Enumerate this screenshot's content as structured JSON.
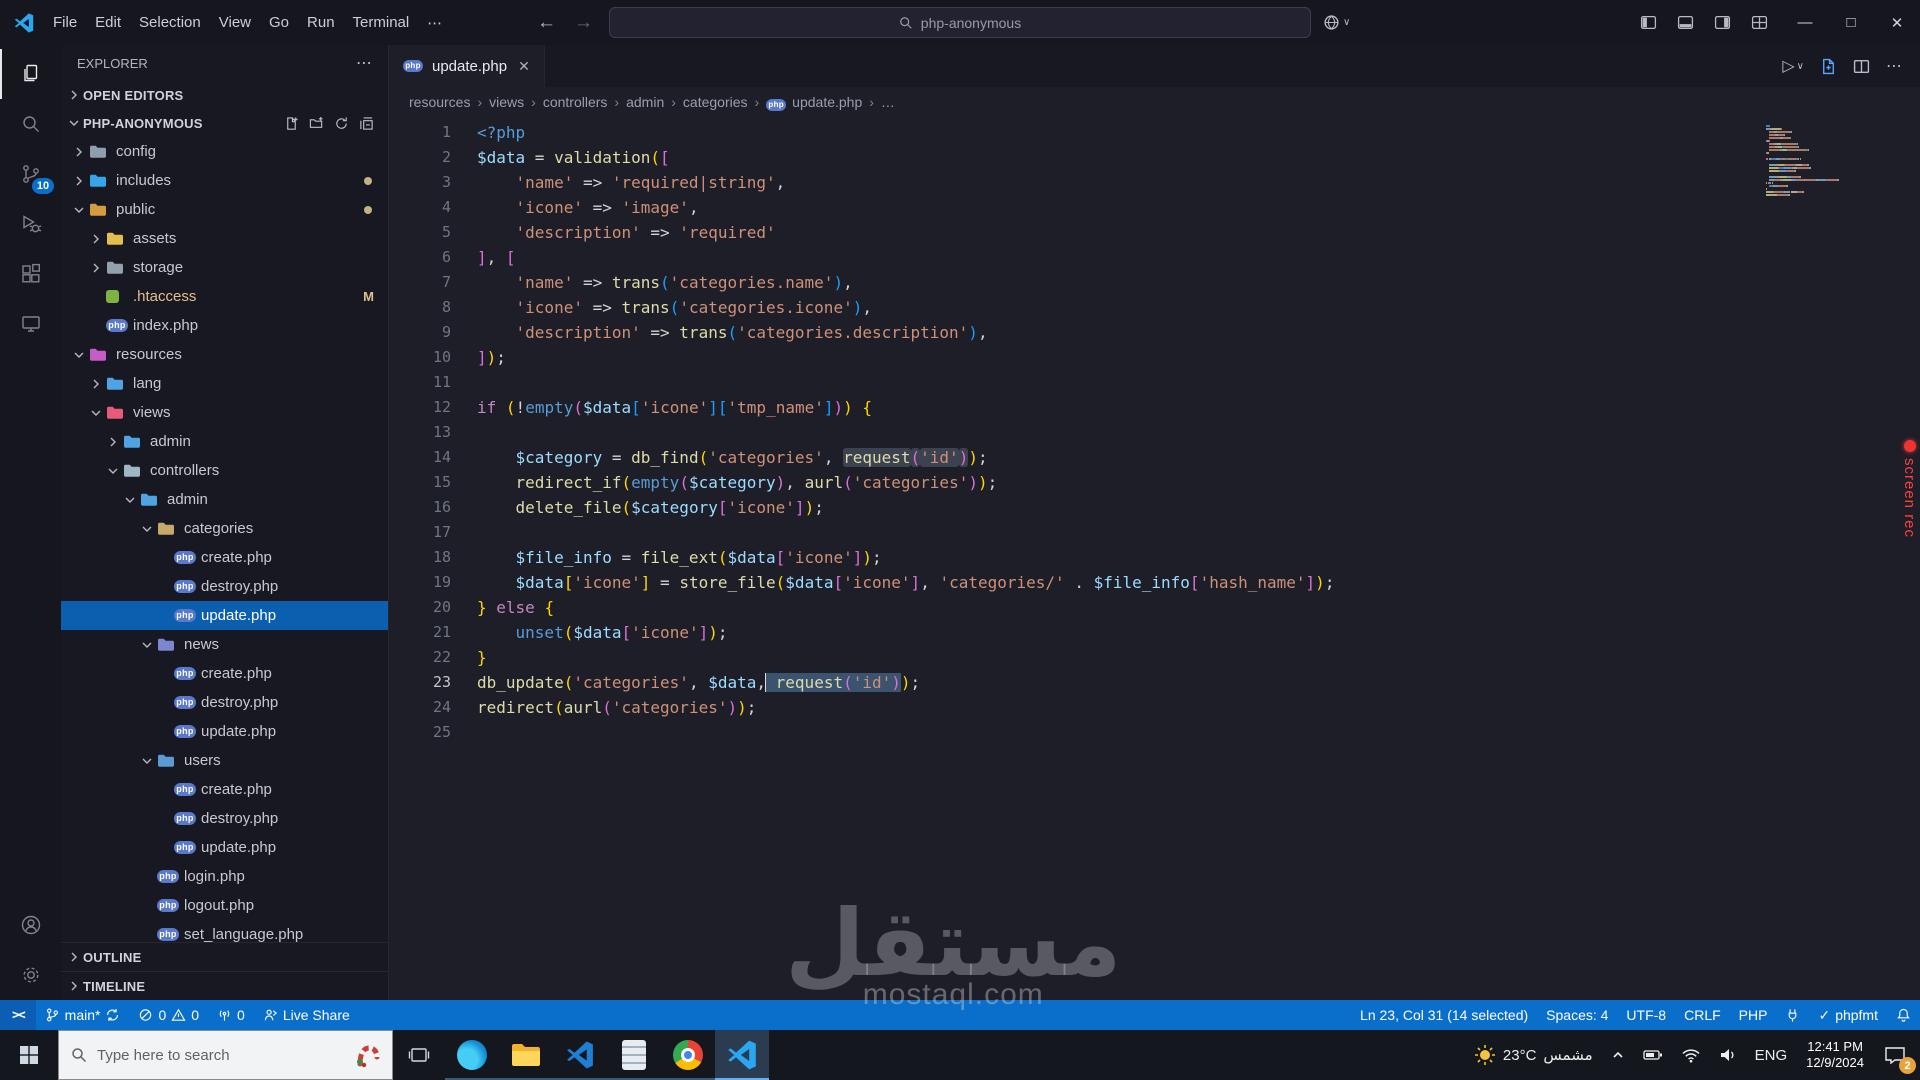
{
  "title_bar": {
    "menus": [
      "File",
      "Edit",
      "Selection",
      "View",
      "Go",
      "Run",
      "Terminal"
    ],
    "search_value": "php-anonymous"
  },
  "glyphs": {
    "more": "⋯",
    "close": "✕",
    "back": "←",
    "forward": "→",
    "crumb_sep": "›",
    "check": "✓",
    "minimize": "—",
    "maximize": "□",
    "caret_down": "∨",
    "play": "▷",
    "remote": "><"
  },
  "activity_bar": {
    "source_control_badge": "10"
  },
  "sidebar": {
    "title": "EXPLORER",
    "open_editors": "OPEN EDITORS",
    "project": "PHP-ANONYMOUS",
    "outline": "OUTLINE",
    "timeline": "TIMELINE",
    "tree": [
      {
        "label": "config",
        "level": 0,
        "kind": "folder",
        "expanded": false,
        "color": "#8f9fb0"
      },
      {
        "label": "includes",
        "level": 0,
        "kind": "folder",
        "expanded": false,
        "color": "#35a4e8",
        "dot": true
      },
      {
        "label": "public",
        "level": 0,
        "kind": "folder",
        "expanded": true,
        "color": "#d79b3f",
        "dot": true
      },
      {
        "label": "assets",
        "level": 1,
        "kind": "folder",
        "expanded": false,
        "color": "#e3bf4e"
      },
      {
        "label": "storage",
        "level": 1,
        "kind": "folder",
        "expanded": false,
        "color": "#93a1ad"
      },
      {
        "label": ".htaccess",
        "level": 1,
        "kind": "file",
        "icon": "htaccess",
        "badge": "M"
      },
      {
        "label": "index.php",
        "level": 1,
        "kind": "file",
        "icon": "php"
      },
      {
        "label": "resources",
        "level": 0,
        "kind": "folder",
        "expanded": true,
        "color": "#c75bc7"
      },
      {
        "label": "lang",
        "level": 1,
        "kind": "folder",
        "expanded": false,
        "color": "#4fa3e3"
      },
      {
        "label": "views",
        "level": 1,
        "kind": "folder",
        "expanded": true,
        "color": "#e8597a"
      },
      {
        "label": "admin",
        "level": 2,
        "kind": "folder",
        "expanded": false,
        "color": "#4fa3e3"
      },
      {
        "label": "controllers",
        "level": 2,
        "kind": "folder",
        "expanded": true,
        "color": "#9fb6c3"
      },
      {
        "label": "admin",
        "level": 3,
        "kind": "folder",
        "expanded": true,
        "color": "#4fa3e3"
      },
      {
        "label": "categories",
        "level": 4,
        "kind": "folder",
        "expanded": true,
        "color": "#c9a96a"
      },
      {
        "label": "create.php",
        "level": 5,
        "kind": "file",
        "icon": "php"
      },
      {
        "label": "destroy.php",
        "level": 5,
        "kind": "file",
        "icon": "php"
      },
      {
        "label": "update.php",
        "level": 5,
        "kind": "file",
        "icon": "php",
        "selected": true
      },
      {
        "label": "news",
        "level": 4,
        "kind": "folder",
        "expanded": true,
        "color": "#7b88cf"
      },
      {
        "label": "create.php",
        "level": 5,
        "kind": "file",
        "icon": "php"
      },
      {
        "label": "destroy.php",
        "level": 5,
        "kind": "file",
        "icon": "php"
      },
      {
        "label": "update.php",
        "level": 5,
        "kind": "file",
        "icon": "php"
      },
      {
        "label": "users",
        "level": 4,
        "kind": "folder",
        "expanded": true,
        "color": "#5a9bd3"
      },
      {
        "label": "create.php",
        "level": 5,
        "kind": "file",
        "icon": "php"
      },
      {
        "label": "destroy.php",
        "level": 5,
        "kind": "file",
        "icon": "php"
      },
      {
        "label": "update.php",
        "level": 5,
        "kind": "file",
        "icon": "php"
      },
      {
        "label": "login.php",
        "level": 4,
        "kind": "file",
        "icon": "php"
      },
      {
        "label": "logout.php",
        "level": 4,
        "kind": "file",
        "icon": "php"
      },
      {
        "label": "set_language.php",
        "level": 4,
        "kind": "file",
        "icon": "php"
      }
    ]
  },
  "editor": {
    "tab_label": "update.php",
    "active_line": 23,
    "breadcrumbs": [
      {
        "label": "resources"
      },
      {
        "label": "views"
      },
      {
        "label": "controllers"
      },
      {
        "label": "admin"
      },
      {
        "label": "categories"
      },
      {
        "label": "update.php",
        "icon": "php"
      },
      {
        "label": "…"
      }
    ],
    "lines": [
      [
        [
          "c",
          "<?php"
        ]
      ],
      [
        [
          "v",
          "$data"
        ],
        [
          "p",
          " = "
        ],
        [
          "f",
          "validation"
        ],
        [
          "g",
          "("
        ],
        [
          "m",
          "["
        ]
      ],
      [
        [
          "p",
          "    "
        ],
        [
          "s",
          "'name'"
        ],
        [
          "p",
          " => "
        ],
        [
          "s",
          "'required|string'"
        ],
        [
          "p",
          ","
        ]
      ],
      [
        [
          "p",
          "    "
        ],
        [
          "s",
          "'icone'"
        ],
        [
          "p",
          " => "
        ],
        [
          "s",
          "'image'"
        ],
        [
          "p",
          ","
        ]
      ],
      [
        [
          "p",
          "    "
        ],
        [
          "s",
          "'description'"
        ],
        [
          "p",
          " => "
        ],
        [
          "s",
          "'required'"
        ]
      ],
      [
        [
          "m",
          "]"
        ],
        [
          "p",
          ", "
        ],
        [
          "m",
          "["
        ]
      ],
      [
        [
          "p",
          "    "
        ],
        [
          "s",
          "'name'"
        ],
        [
          "p",
          " => "
        ],
        [
          "f",
          "trans"
        ],
        [
          "b",
          "("
        ],
        [
          "s",
          "'categories.name'"
        ],
        [
          "b",
          ")"
        ],
        [
          "p",
          ","
        ]
      ],
      [
        [
          "p",
          "    "
        ],
        [
          "s",
          "'icone'"
        ],
        [
          "p",
          " => "
        ],
        [
          "f",
          "trans"
        ],
        [
          "b",
          "("
        ],
        [
          "s",
          "'categories.icone'"
        ],
        [
          "b",
          ")"
        ],
        [
          "p",
          ","
        ]
      ],
      [
        [
          "p",
          "    "
        ],
        [
          "s",
          "'description'"
        ],
        [
          "p",
          " => "
        ],
        [
          "f",
          "trans"
        ],
        [
          "b",
          "("
        ],
        [
          "s",
          "'categories.description'"
        ],
        [
          "b",
          ")"
        ],
        [
          "p",
          ","
        ]
      ],
      [
        [
          "m",
          "]"
        ],
        [
          "g",
          ")"
        ],
        [
          "p",
          ";"
        ]
      ],
      [],
      [
        [
          "k",
          "if"
        ],
        [
          "p",
          " "
        ],
        [
          "g",
          "("
        ],
        [
          "p",
          "!"
        ],
        [
          "c",
          "empty"
        ],
        [
          "m",
          "("
        ],
        [
          "v",
          "$data"
        ],
        [
          "b",
          "["
        ],
        [
          "s",
          "'icone'"
        ],
        [
          "b",
          "]"
        ],
        [
          "b",
          "["
        ],
        [
          "s",
          "'tmp_name'"
        ],
        [
          "b",
          "]"
        ],
        [
          "m",
          ")"
        ],
        [
          "g",
          ")"
        ],
        [
          "p",
          " "
        ],
        [
          "g",
          "{"
        ]
      ],
      [],
      [
        [
          "p",
          "    "
        ],
        [
          "v",
          "$category"
        ],
        [
          "p",
          " = "
        ],
        [
          "f",
          "db_find"
        ],
        [
          "g",
          "("
        ],
        [
          "s",
          "'categories'"
        ],
        [
          "p",
          ", "
        ],
        [
          "f",
          "request",
          "match"
        ],
        [
          "m",
          "(",
          "match"
        ],
        [
          "s",
          "'id'",
          "match"
        ],
        [
          "m",
          ")",
          "match"
        ],
        [
          "g",
          ")"
        ],
        [
          "p",
          ";"
        ]
      ],
      [
        [
          "p",
          "    "
        ],
        [
          "f",
          "redirect_if"
        ],
        [
          "g",
          "("
        ],
        [
          "c",
          "empty"
        ],
        [
          "m",
          "("
        ],
        [
          "v",
          "$category"
        ],
        [
          "m",
          ")"
        ],
        [
          "p",
          ", "
        ],
        [
          "f",
          "aurl"
        ],
        [
          "m",
          "("
        ],
        [
          "s",
          "'categories'"
        ],
        [
          "m",
          ")"
        ],
        [
          "g",
          ")"
        ],
        [
          "p",
          ";"
        ]
      ],
      [
        [
          "p",
          "    "
        ],
        [
          "f",
          "delete_file"
        ],
        [
          "g",
          "("
        ],
        [
          "v",
          "$category"
        ],
        [
          "m",
          "["
        ],
        [
          "s",
          "'icone'"
        ],
        [
          "m",
          "]"
        ],
        [
          "g",
          ")"
        ],
        [
          "p",
          ";"
        ]
      ],
      [],
      [
        [
          "p",
          "    "
        ],
        [
          "v",
          "$file_info"
        ],
        [
          "p",
          " = "
        ],
        [
          "f",
          "file_ext"
        ],
        [
          "g",
          "("
        ],
        [
          "v",
          "$data"
        ],
        [
          "m",
          "["
        ],
        [
          "s",
          "'icone'"
        ],
        [
          "m",
          "]"
        ],
        [
          "g",
          ")"
        ],
        [
          "p",
          ";"
        ]
      ],
      [
        [
          "p",
          "    "
        ],
        [
          "v",
          "$data"
        ],
        [
          "g",
          "["
        ],
        [
          "s",
          "'icone'"
        ],
        [
          "g",
          "]"
        ],
        [
          "p",
          " = "
        ],
        [
          "f",
          "store_file"
        ],
        [
          "g",
          "("
        ],
        [
          "v",
          "$data"
        ],
        [
          "m",
          "["
        ],
        [
          "s",
          "'icone'"
        ],
        [
          "m",
          "]"
        ],
        [
          "p",
          ", "
        ],
        [
          "s",
          "'categories/'"
        ],
        [
          "p",
          " . "
        ],
        [
          "v",
          "$file_info"
        ],
        [
          "m",
          "["
        ],
        [
          "s",
          "'hash_name'"
        ],
        [
          "m",
          "]"
        ],
        [
          "g",
          ")"
        ],
        [
          "p",
          ";"
        ]
      ],
      [
        [
          "g",
          "}"
        ],
        [
          "p",
          " "
        ],
        [
          "k",
          "else"
        ],
        [
          "p",
          " "
        ],
        [
          "g",
          "{"
        ]
      ],
      [
        [
          "p",
          "    "
        ],
        [
          "c",
          "unset"
        ],
        [
          "g",
          "("
        ],
        [
          "v",
          "$data"
        ],
        [
          "m",
          "["
        ],
        [
          "s",
          "'icone'"
        ],
        [
          "m",
          "]"
        ],
        [
          "g",
          ")"
        ],
        [
          "p",
          ";"
        ]
      ],
      [
        [
          "g",
          "}"
        ]
      ],
      [
        [
          "f",
          "db_update"
        ],
        [
          "g",
          "("
        ],
        [
          "s",
          "'categories'"
        ],
        [
          "p",
          ", "
        ],
        [
          "v",
          "$data"
        ],
        [
          "p",
          ","
        ],
        [
          "caret",
          ""
        ],
        [
          "p",
          " ",
          "sel"
        ],
        [
          "f",
          "request",
          "sel"
        ],
        [
          "m",
          "(",
          "sel"
        ],
        [
          "s",
          "'id'",
          "sel"
        ],
        [
          "m",
          ")",
          "sel"
        ],
        [
          "g",
          ")"
        ],
        [
          "p",
          ";"
        ]
      ],
      [
        [
          "f",
          "redirect"
        ],
        [
          "g",
          "("
        ],
        [
          "f",
          "aurl"
        ],
        [
          "m",
          "("
        ],
        [
          "s",
          "'categories'"
        ],
        [
          "m",
          ")"
        ],
        [
          "g",
          ")"
        ],
        [
          "p",
          ";"
        ]
      ],
      []
    ]
  },
  "status_bar": {
    "branch": "main*",
    "errors": "0",
    "warnings": "0",
    "ports": "0",
    "live_share": "Live Share",
    "cursor": "Ln 23, Col 31 (14 selected)",
    "indent": "Spaces: 4",
    "encoding": "UTF-8",
    "eol": "CRLF",
    "language": "PHP",
    "formatter": "phpfmt"
  },
  "taskbar": {
    "search_placeholder": "Type here to search",
    "weather_temp": "23°C",
    "weather_desc": "مشمس",
    "language": "ENG",
    "time": "12:41 PM",
    "date": "12/9/2024",
    "notification_badge": "2"
  },
  "watermark": {
    "arabic": "مستقل",
    "latin": "mostaql.com"
  },
  "screen_rec_label": "screen rec"
}
